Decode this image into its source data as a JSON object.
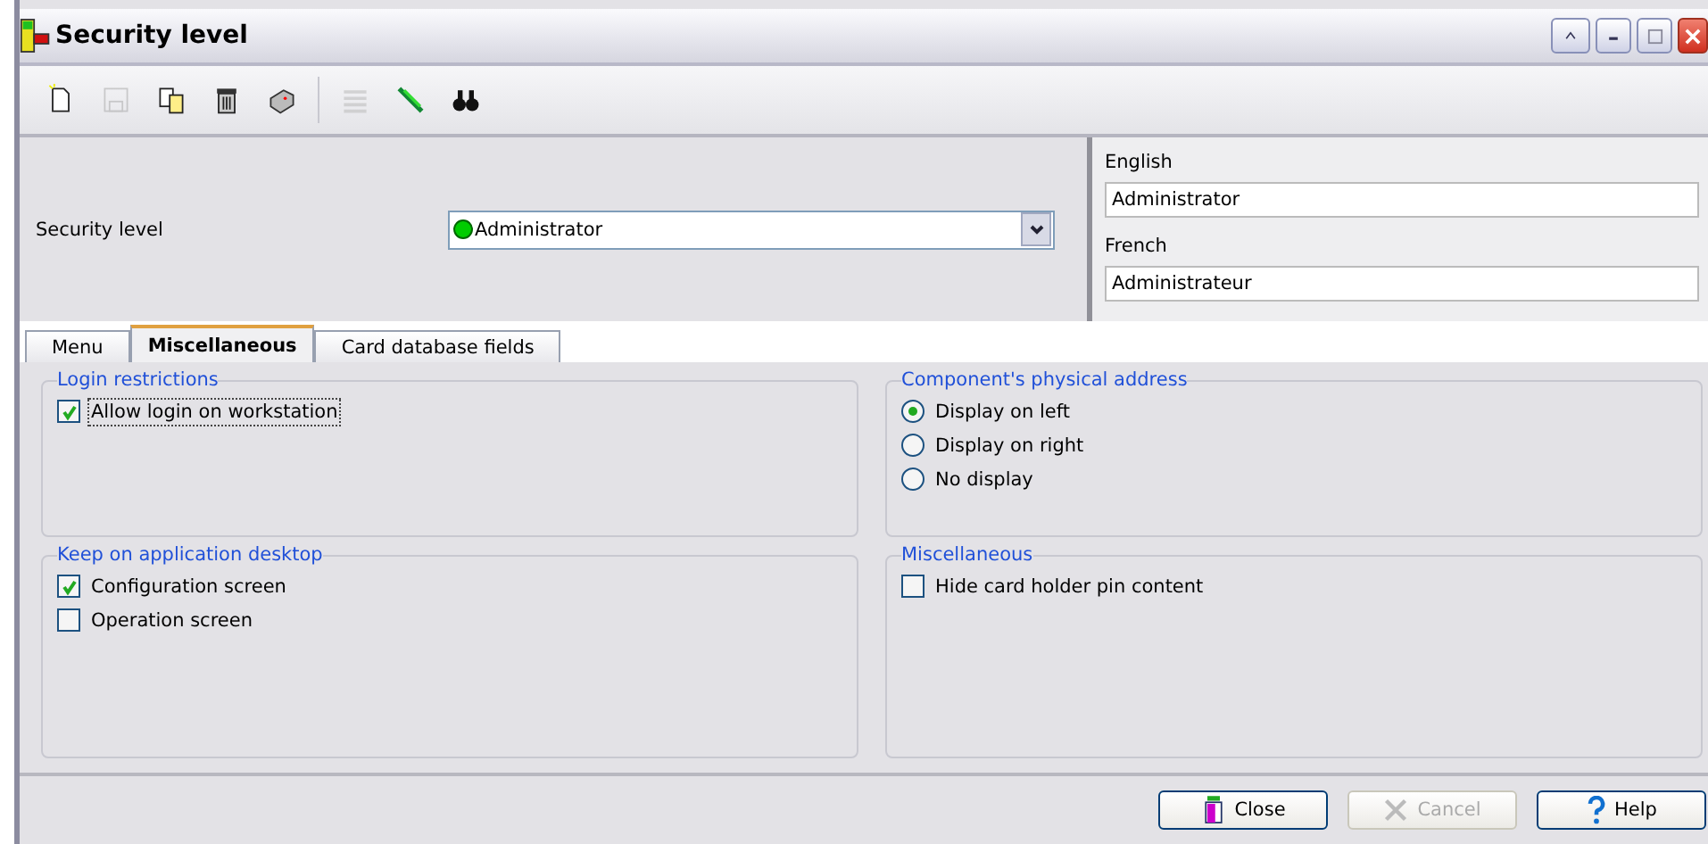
{
  "window": {
    "title": "Security level"
  },
  "toolbar": [
    {
      "kind": "new",
      "disabled": false
    },
    {
      "kind": "save",
      "disabled": true
    },
    {
      "kind": "copy",
      "disabled": false
    },
    {
      "kind": "delete",
      "disabled": false
    },
    {
      "kind": "print",
      "disabled": false
    },
    {
      "kind": "separator"
    },
    {
      "kind": "list",
      "disabled": true
    },
    {
      "kind": "link",
      "disabled": false
    },
    {
      "kind": "find",
      "disabled": false
    }
  ],
  "security_level": {
    "label": "Security level",
    "value": "Administrator",
    "color": "#00cc00"
  },
  "languages": [
    {
      "label": "English",
      "value": "Administrator"
    },
    {
      "label": "French",
      "value": "Administrateur"
    }
  ],
  "tabs": [
    {
      "label": "Menu",
      "selected": false
    },
    {
      "label": "Miscellaneous",
      "selected": true
    },
    {
      "label": "Card database fields",
      "selected": false
    }
  ],
  "groups": [
    {
      "title": "Login restrictions",
      "items": [
        {
          "kind": "checkbox",
          "label": "Allow login on workstation",
          "checked": true,
          "focused": true
        }
      ]
    },
    {
      "title": "Component's physical address",
      "items": [
        {
          "kind": "radio",
          "label": "Display on left",
          "selected": true
        },
        {
          "kind": "radio",
          "label": "Display on right",
          "selected": false
        },
        {
          "kind": "radio",
          "label": "No display",
          "selected": false
        }
      ]
    },
    {
      "title": "Keep on application desktop",
      "items": [
        {
          "kind": "checkbox",
          "label": "Configuration screen",
          "checked": true
        },
        {
          "kind": "checkbox",
          "label": "Operation screen",
          "checked": false
        }
      ]
    },
    {
      "title": "Miscellaneous",
      "items": [
        {
          "kind": "checkbox",
          "label": "Hide card holder pin content",
          "checked": false
        }
      ]
    }
  ],
  "buttons": [
    {
      "kind": "close",
      "label": "Close",
      "disabled": false
    },
    {
      "kind": "cancel",
      "label": "Cancel",
      "disabled": true
    },
    {
      "kind": "help",
      "label": "Help",
      "disabled": false
    }
  ]
}
